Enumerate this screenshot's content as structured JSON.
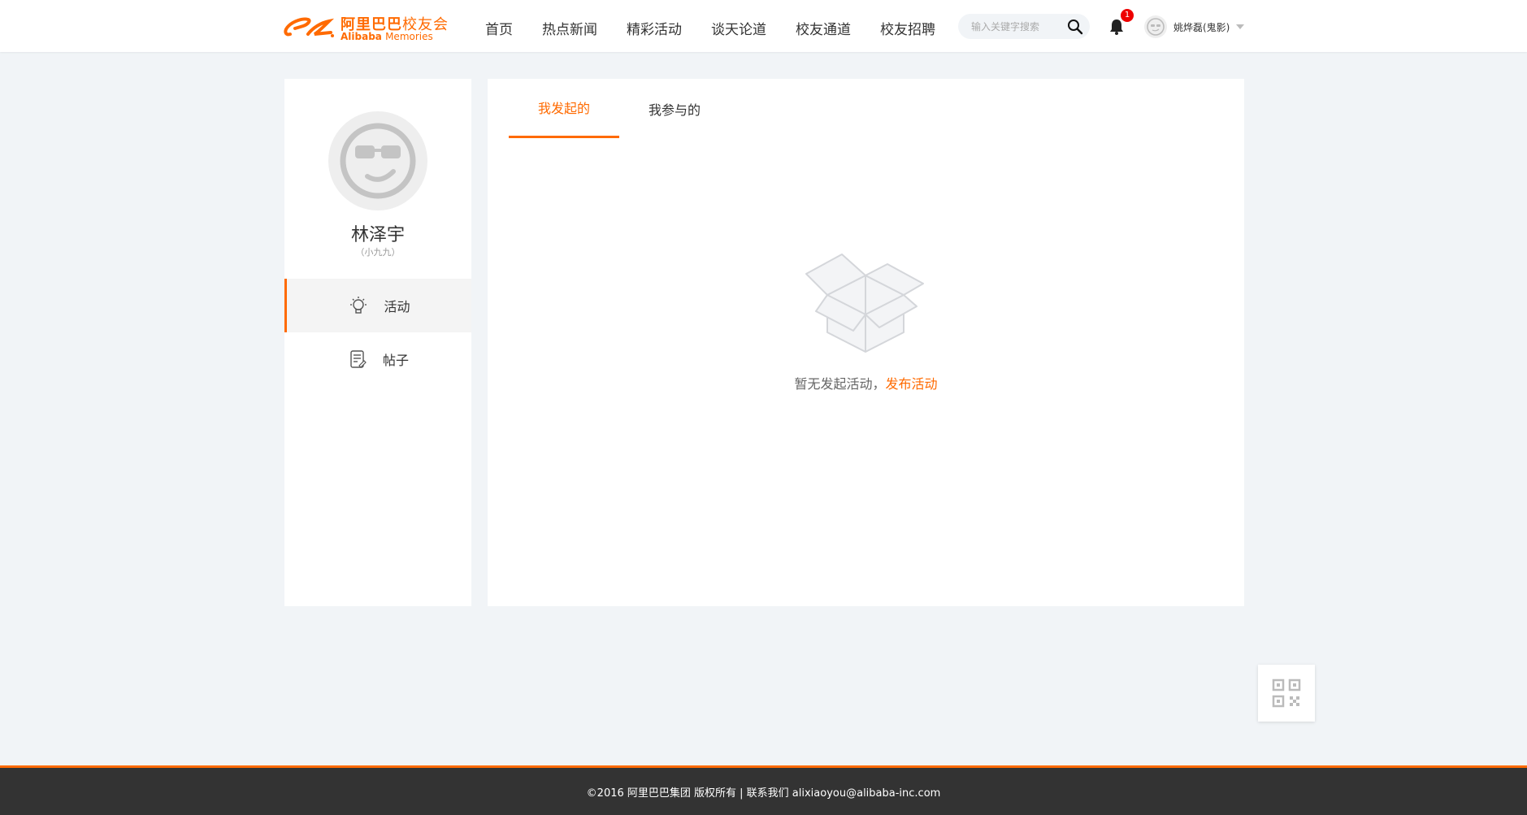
{
  "header": {
    "logo_cn_bold": "阿里巴巴",
    "logo_cn_light": "校友会",
    "logo_en_bold": "Alibaba",
    "logo_en_light": "Memories",
    "nav": [
      "首页",
      "热点新闻",
      "精彩活动",
      "谈天论道",
      "校友通道",
      "校友招聘"
    ],
    "search_placeholder": "输入关键字搜索",
    "notification_count": "1",
    "user_name": "姚烨磊(鬼影)"
  },
  "profile": {
    "name": "林泽宇",
    "nickname": "（小九九）"
  },
  "sidebar": {
    "items": [
      {
        "label": "活动",
        "icon": "lightbulb-icon",
        "active": true
      },
      {
        "label": "帖子",
        "icon": "document-icon",
        "active": false
      }
    ]
  },
  "main": {
    "tabs": [
      {
        "label": "我发起的",
        "active": true
      },
      {
        "label": "我参与的",
        "active": false
      }
    ],
    "empty_text": "暂无发起活动，",
    "empty_link": "发布活动"
  },
  "footer": {
    "text": "©2016 阿里巴巴集团 版权所有 | 联系我们 alixiaoyou@alibaba-inc.com"
  },
  "colors": {
    "accent": "#ff6a00",
    "background": "#f1f4f7",
    "footer": "#333333",
    "badge": "#ee0000"
  }
}
